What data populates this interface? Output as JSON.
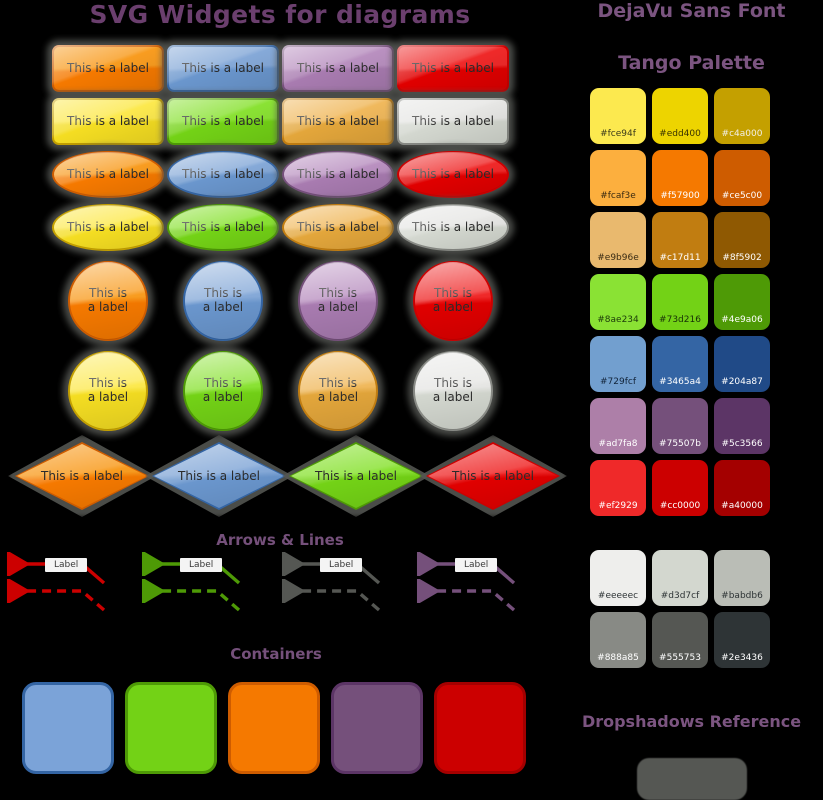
{
  "headings": {
    "main_title": "SVG Widgets for diagrams",
    "font_title": "DejaVu Sans Font",
    "palette_title": "Tango Palette",
    "arrows_title": "Arrows & Lines",
    "containers_title": "Containers",
    "dropshadows_title": "Dropshadows Reference"
  },
  "widget_label": "This is a label",
  "widget_label_l1": "This is",
  "widget_label_l2": "a label",
  "arrow_label": "Label",
  "widgets": {
    "rounded_rects_row1": [
      {
        "name": "orange",
        "fill": "#f89c20",
        "fill2": "#f57900",
        "stroke": "#ce5c00"
      },
      {
        "name": "blue",
        "fill": "#85a9d8",
        "fill2": "#6a96cd",
        "stroke": "#3465a4"
      },
      {
        "name": "purple",
        "fill": "#b990c0",
        "fill2": "#a87bb0",
        "stroke": "#75507b"
      },
      {
        "name": "red",
        "fill": "#ef2929",
        "fill2": "#e00000",
        "stroke": "#cc0000"
      }
    ],
    "rounded_rects_row2": [
      {
        "name": "yellow",
        "fill": "#fce94f",
        "fill2": "#f4dd22",
        "stroke": "#c4a000"
      },
      {
        "name": "green",
        "fill": "#8ae234",
        "fill2": "#73d216",
        "stroke": "#4e9a06"
      },
      {
        "name": "tan",
        "fill": "#f0b95d",
        "fill2": "#e3a63b",
        "stroke": "#c17d11"
      },
      {
        "name": "grey",
        "fill": "#e6e6e4",
        "fill2": "#d3d7cf",
        "stroke": "#888a85"
      }
    ],
    "ellipses_row1": [
      {
        "name": "orange",
        "fill": "#f89c20",
        "fill2": "#f57900",
        "stroke": "#ce5c00"
      },
      {
        "name": "blue",
        "fill": "#85a9d8",
        "fill2": "#6a96cd",
        "stroke": "#3465a4"
      },
      {
        "name": "purple",
        "fill": "#b990c0",
        "fill2": "#a87bb0",
        "stroke": "#75507b"
      },
      {
        "name": "red",
        "fill": "#ef2929",
        "fill2": "#e00000",
        "stroke": "#cc0000"
      }
    ],
    "ellipses_row2": [
      {
        "name": "yellow",
        "fill": "#fce94f",
        "fill2": "#f4dd22",
        "stroke": "#c4a000"
      },
      {
        "name": "green",
        "fill": "#8ae234",
        "fill2": "#73d216",
        "stroke": "#4e9a06"
      },
      {
        "name": "tan",
        "fill": "#f0b95d",
        "fill2": "#e3a63b",
        "stroke": "#c17d11"
      },
      {
        "name": "grey",
        "fill": "#e6e6e4",
        "fill2": "#d3d7cf",
        "stroke": "#888a85"
      }
    ],
    "circles_row1": [
      {
        "name": "orange",
        "fill": "#f89c20",
        "fill2": "#f57900",
        "stroke": "#ce5c00"
      },
      {
        "name": "blue",
        "fill": "#85a9d8",
        "fill2": "#6a96cd",
        "stroke": "#3465a4"
      },
      {
        "name": "purple",
        "fill": "#b990c0",
        "fill2": "#a87bb0",
        "stroke": "#75507b"
      },
      {
        "name": "red",
        "fill": "#ef2929",
        "fill2": "#e00000",
        "stroke": "#cc0000"
      }
    ],
    "circles_row2": [
      {
        "name": "yellow",
        "fill": "#fce94f",
        "fill2": "#f4dd22",
        "stroke": "#c4a000"
      },
      {
        "name": "green",
        "fill": "#8ae234",
        "fill2": "#73d216",
        "stroke": "#4e9a06"
      },
      {
        "name": "tan",
        "fill": "#f0b95d",
        "fill2": "#e3a63b",
        "stroke": "#c17d11"
      },
      {
        "name": "grey",
        "fill": "#e6e6e4",
        "fill2": "#d3d7cf",
        "stroke": "#888a85"
      }
    ],
    "diamonds": [
      {
        "name": "orange",
        "fill": "#f89c20",
        "fill2": "#f57900",
        "stroke": "#ce5c00"
      },
      {
        "name": "blue",
        "fill": "#85a9d8",
        "fill2": "#6a96cd",
        "stroke": "#3465a4"
      },
      {
        "name": "green",
        "fill": "#8ae234",
        "fill2": "#73d216",
        "stroke": "#4e9a06"
      },
      {
        "name": "red",
        "fill": "#ef2929",
        "fill2": "#e00000",
        "stroke": "#cc0000"
      }
    ],
    "containers": [
      {
        "name": "blue",
        "fill": "#7ba3d8",
        "stroke": "#3465a4"
      },
      {
        "name": "green",
        "fill": "#73d216",
        "stroke": "#4e9a06"
      },
      {
        "name": "orange",
        "fill": "#f57900",
        "stroke": "#ce5c00"
      },
      {
        "name": "purple",
        "fill": "#75507b",
        "stroke": "#5c3566"
      },
      {
        "name": "red",
        "fill": "#cc0000",
        "stroke": "#a40000"
      }
    ]
  },
  "arrows": [
    {
      "name": "red-solid",
      "color": "#cc0000",
      "style": "solid",
      "label": "Label"
    },
    {
      "name": "red-dashed",
      "color": "#cc0000",
      "style": "dashed",
      "label": ""
    },
    {
      "name": "green-solid",
      "color": "#4e9a06",
      "style": "solid",
      "label": "Label"
    },
    {
      "name": "green-dashed",
      "color": "#4e9a06",
      "style": "dashed",
      "label": ""
    },
    {
      "name": "grey-solid",
      "color": "#555753",
      "style": "solid",
      "label": "Label"
    },
    {
      "name": "grey-dashed",
      "color": "#555753",
      "style": "dashed",
      "label": ""
    },
    {
      "name": "purple-solid",
      "color": "#75507b",
      "style": "solid",
      "label": "Label"
    },
    {
      "name": "purple-dashed",
      "color": "#75507b",
      "style": "dashed",
      "label": ""
    }
  ],
  "palette": {
    "rows": [
      [
        {
          "hex": "#fce94f",
          "text": "#3a3a1a"
        },
        {
          "hex": "#edd400",
          "text": "#3a3300"
        },
        {
          "hex": "#c4a000",
          "text": "#f2efe5"
        }
      ],
      [
        {
          "hex": "#fcaf3e",
          "text": "#3a2a10"
        },
        {
          "hex": "#f57900",
          "text": "#ffffff"
        },
        {
          "hex": "#ce5c00",
          "text": "#ffffff"
        }
      ],
      [
        {
          "hex": "#e9b96e",
          "text": "#3a2c14"
        },
        {
          "hex": "#c17d11",
          "text": "#ffffff"
        },
        {
          "hex": "#8f5902",
          "text": "#ffffff"
        }
      ],
      [
        {
          "hex": "#8ae234",
          "text": "#1c3a0a"
        },
        {
          "hex": "#73d216",
          "text": "#183008"
        },
        {
          "hex": "#4e9a06",
          "text": "#ffffff"
        }
      ],
      [
        {
          "hex": "#729fcf",
          "text": "#12243a"
        },
        {
          "hex": "#3465a4",
          "text": "#ffffff"
        },
        {
          "hex": "#204a87",
          "text": "#ffffff"
        }
      ],
      [
        {
          "hex": "#ad7fa8",
          "text": "#ffffff"
        },
        {
          "hex": "#75507b",
          "text": "#ffffff"
        },
        {
          "hex": "#5c3566",
          "text": "#ffffff"
        }
      ],
      [
        {
          "hex": "#ef2929",
          "text": "#ffffff"
        },
        {
          "hex": "#cc0000",
          "text": "#ffffff"
        },
        {
          "hex": "#a40000",
          "text": "#ffffff"
        }
      ]
    ],
    "greys": [
      [
        {
          "hex": "#eeeeec",
          "text": "#2e3436"
        },
        {
          "hex": "#d3d7cf",
          "text": "#2e3436"
        },
        {
          "hex": "#babdb6",
          "text": "#2e3436"
        }
      ],
      [
        {
          "hex": "#888a85",
          "text": "#ffffff"
        },
        {
          "hex": "#555753",
          "text": "#ffffff"
        },
        {
          "hex": "#2e3436",
          "text": "#ffffff"
        }
      ]
    ]
  }
}
